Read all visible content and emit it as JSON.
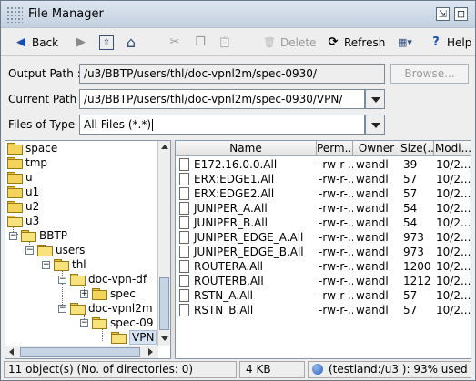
{
  "window": {
    "title": "File Manager",
    "minimize_glyph": "⇲",
    "maximize_glyph": "⊡"
  },
  "toolbar": {
    "back": {
      "label": "Back",
      "icon": "arrow-left-icon",
      "glyph": "◀"
    },
    "forward": {
      "icon": "arrow-right-icon",
      "glyph": "▶"
    },
    "up": {
      "icon": "folder-up-icon",
      "glyph": "⇧"
    },
    "home": {
      "icon": "home-icon",
      "glyph": "⌂"
    },
    "cut": {
      "icon": "scissors-icon",
      "glyph": "✂"
    },
    "copy": {
      "icon": "copy-icon",
      "glyph": "❐"
    },
    "paste": {
      "icon": "paste-icon",
      "glyph": "📋"
    },
    "delete": {
      "label": "Delete",
      "icon": "trash-icon",
      "glyph": "🗑"
    },
    "refresh": {
      "label": "Refresh",
      "icon": "refresh-icon",
      "glyph": "⟳"
    },
    "view": {
      "icon": "view-options-icon",
      "glyph": "▦▾"
    },
    "help": {
      "label": "Help",
      "icon": "help-icon",
      "glyph": "?"
    }
  },
  "output_path": {
    "label": "Output Path :",
    "value": "/u3/BBTP/users/thl/doc-vpnl2m/spec-0930/",
    "browse_label": "Browse..."
  },
  "current_path": {
    "label": "Current Path :",
    "value": "/u3/BBTP/users/thl/doc-vpnl2m/spec-0930/VPN/"
  },
  "file_type": {
    "label": "Files of Type :",
    "value": "All Files (*.*)"
  },
  "tree": {
    "nodes": [
      {
        "label": "space"
      },
      {
        "label": "tmp"
      },
      {
        "label": "u"
      },
      {
        "label": "u1"
      },
      {
        "label": "u2"
      },
      {
        "label": "u3"
      },
      {
        "label": "BBTP"
      },
      {
        "label": "users"
      },
      {
        "label": "thl"
      },
      {
        "label": "doc-vpn-df"
      },
      {
        "label": "spec"
      },
      {
        "label": "doc-vpnl2m"
      },
      {
        "label": "spec-09"
      },
      {
        "label": "VPN"
      }
    ],
    "expand_glyph": "+",
    "collapse_glyph": "−"
  },
  "list": {
    "columns": [
      "Name",
      "Perm...",
      "Owner",
      "Size(...",
      "Modi..."
    ],
    "rows": [
      {
        "name": "E172.16.0.0.All",
        "perm": "-rw-r-...",
        "owner": "wandl",
        "size": "39",
        "modified": "10/2..."
      },
      {
        "name": "ERX:EDGE1.All",
        "perm": "-rw-r-...",
        "owner": "wandl",
        "size": "57",
        "modified": "10/2..."
      },
      {
        "name": "ERX:EDGE2.All",
        "perm": "-rw-r-...",
        "owner": "wandl",
        "size": "57",
        "modified": "10/2..."
      },
      {
        "name": "JUNIPER_A.All",
        "perm": "-rw-r-...",
        "owner": "wandl",
        "size": "54",
        "modified": "10/2..."
      },
      {
        "name": "JUNIPER_B.All",
        "perm": "-rw-r-...",
        "owner": "wandl",
        "size": "54",
        "modified": "10/2..."
      },
      {
        "name": "JUNIPER_EDGE_A.All",
        "perm": "-rw-r-...",
        "owner": "wandl",
        "size": "973",
        "modified": "10/2..."
      },
      {
        "name": "JUNIPER_EDGE_B.All",
        "perm": "-rw-r-...",
        "owner": "wandl",
        "size": "973",
        "modified": "10/2..."
      },
      {
        "name": "ROUTERA.All",
        "perm": "-rw-r-...",
        "owner": "wandl",
        "size": "1200",
        "modified": "10/2..."
      },
      {
        "name": "ROUTERB.All",
        "perm": "-rw-r-...",
        "owner": "wandl",
        "size": "1212",
        "modified": "10/2..."
      },
      {
        "name": "RSTN_A.All",
        "perm": "-rw-r-...",
        "owner": "wandl",
        "size": "57",
        "modified": "10/2..."
      },
      {
        "name": "RSTN_B.All",
        "perm": "-rw-r-...",
        "owner": "wandl",
        "size": "57",
        "modified": "10/2..."
      }
    ]
  },
  "status": {
    "objects": "11 object(s) (No. of directories: 0)",
    "size": "4 KB",
    "disk": "(testland:/u3 ): 93% used"
  }
}
